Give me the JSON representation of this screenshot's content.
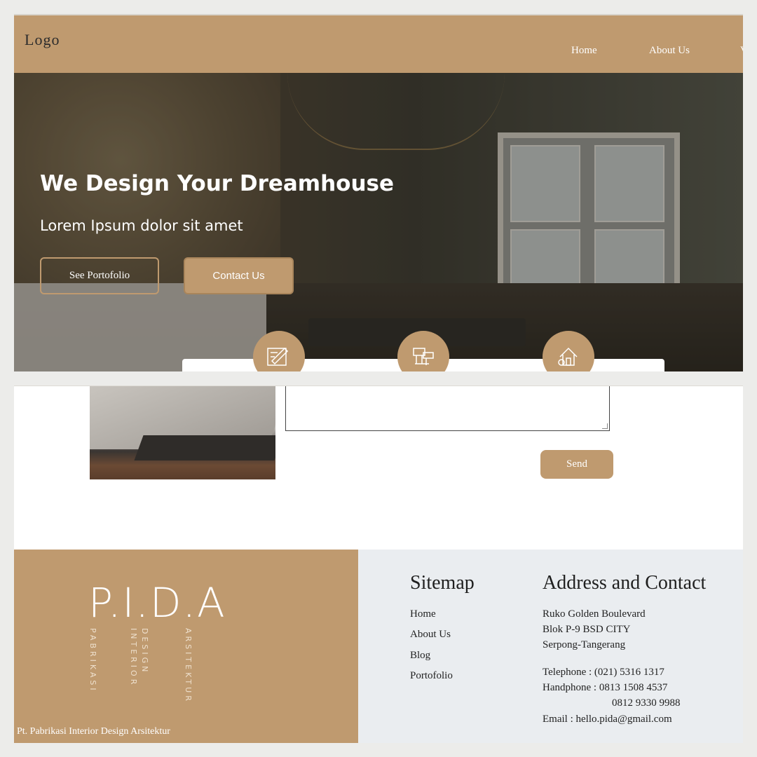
{
  "header": {
    "logo": "Logo",
    "nav": [
      "Home",
      "About Us",
      "V"
    ]
  },
  "hero": {
    "title": "We Design Your Dreamhouse",
    "subtitle": "Lorem Ipsum dolor sit amet",
    "btn_portfolio": "See Portofolio",
    "btn_contact": "Contact Us"
  },
  "contact_form": {
    "send_label": "Send"
  },
  "footer": {
    "brand": "P.I.D.A",
    "brand_words": [
      "PABRIKASI",
      "INTERIOR",
      "DESIGN",
      "ARSITEKTUR"
    ],
    "copyright": "Pt. Pabrikasi Interior Design Arsitektur",
    "sitemap": {
      "heading": "Sitemap",
      "links": [
        "Home",
        "About Us",
        "Blog",
        "Portofolio"
      ]
    },
    "address": {
      "heading": "Address and Contact",
      "lines": [
        "Ruko Golden Boulevard",
        "Blok P-9 BSD CITY",
        "Serpong-Tangerang"
      ],
      "telephone": "Telephone : (021) 5316 1317",
      "handphone": "Handphone : 0813 1508 4537",
      "handphone2": "0812 9330 9988",
      "email": "Email : hello.pida@gmail.com"
    }
  },
  "colors": {
    "accent": "#bf9a6f",
    "footer_right_bg": "#eaedf0"
  },
  "icons": [
    "blueprint-icon",
    "furniture-icon",
    "house-icon"
  ]
}
